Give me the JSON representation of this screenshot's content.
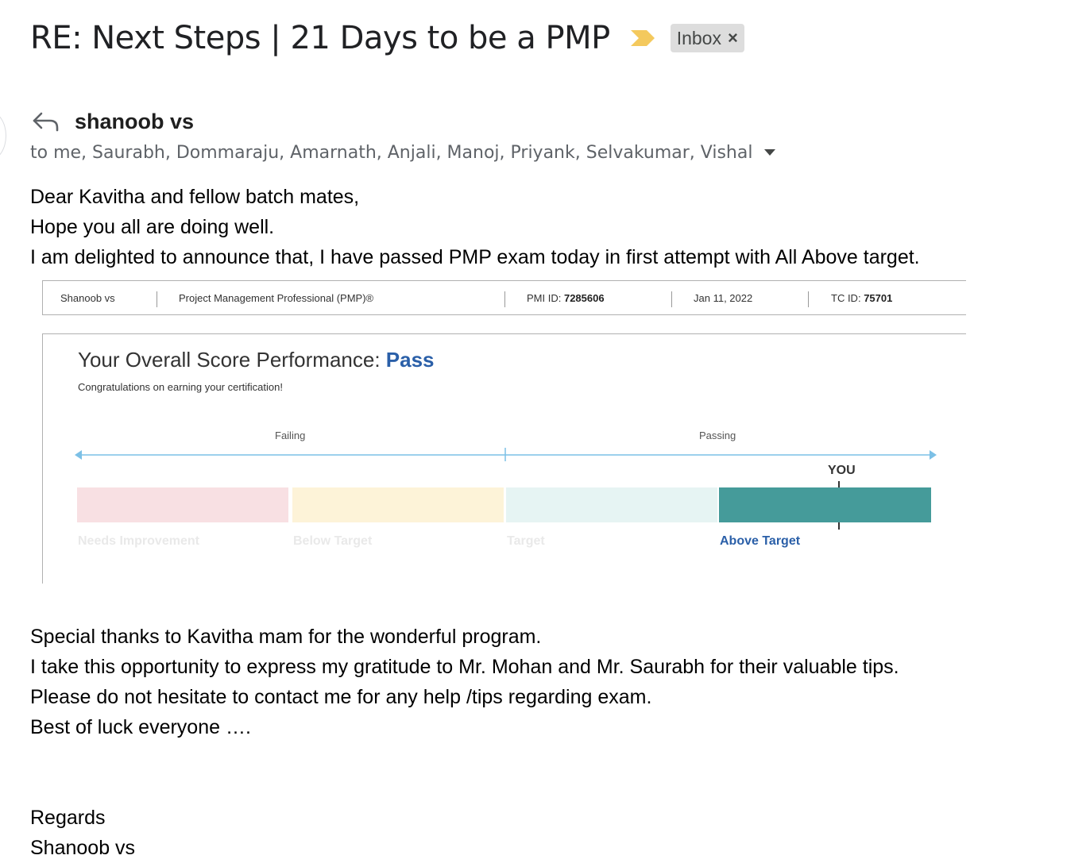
{
  "email": {
    "subject": "RE: Next Steps | 21 Days to be a PMP",
    "importance_icon": "importance-marker-icon",
    "label_chip": {
      "text": "Inbox",
      "remove": "×"
    },
    "sender": {
      "name": "shanoob vs"
    },
    "recipients": "to me, Saurabh, Dommaraju, Amarnath, Anjali, Manoj, Priyank, Selvakumar, Vishal",
    "colors": {
      "importance": "#f4c95d",
      "chip_bg": "#dddddd",
      "recipients": "#5f6368"
    }
  },
  "body": {
    "intro": [
      "Dear Kavitha and fellow batch mates,",
      "Hope you all are doing well.",
      "I am delighted to announce that, I have passed PMP exam today in first attempt with All Above target."
    ],
    "outro": [
      "Special thanks to Kavitha mam for the wonderful program.",
      "I take this opportunity to express my gratitude to Mr. Mohan and Mr. Saurabh for their valuable tips.",
      "Please do not hesitate to contact me for any help /tips regarding exam.",
      "Best of luck everyone …."
    ],
    "signoff": [
      "Regards",
      "Shanoob vs"
    ]
  },
  "report": {
    "candidate": "Shanoob vs",
    "certification": "Project Management Professional (PMP)®",
    "pmi_id_label": "PMI ID:",
    "pmi_id": "7285606",
    "date": "Jan 11, 2022",
    "tc_id_label": "TC ID:",
    "tc_id": "75701",
    "title_prefix": "Your Overall Score Performance:",
    "result": "Pass",
    "congrats": "Congratulations on earning your certification!",
    "scale": {
      "failing": "Failing",
      "passing": "Passing"
    },
    "marker_label": "YOU",
    "bands": [
      {
        "label": "Needs Improvement",
        "color": "#f8e0e3",
        "label_color": "#e9e9e9"
      },
      {
        "label": "Below Target",
        "color": "#fdf3d8",
        "label_color": "#e9e9e9"
      },
      {
        "label": "Target",
        "color": "#e6f4f3",
        "label_color": "#e9e9e9"
      },
      {
        "label": "Above Target",
        "color": "#459b9a",
        "label_color": "#2a5fa8"
      }
    ],
    "achieved_band": "Above Target",
    "colors": {
      "pass": "#2a5fa8",
      "axis": "#7cc0e6"
    }
  }
}
